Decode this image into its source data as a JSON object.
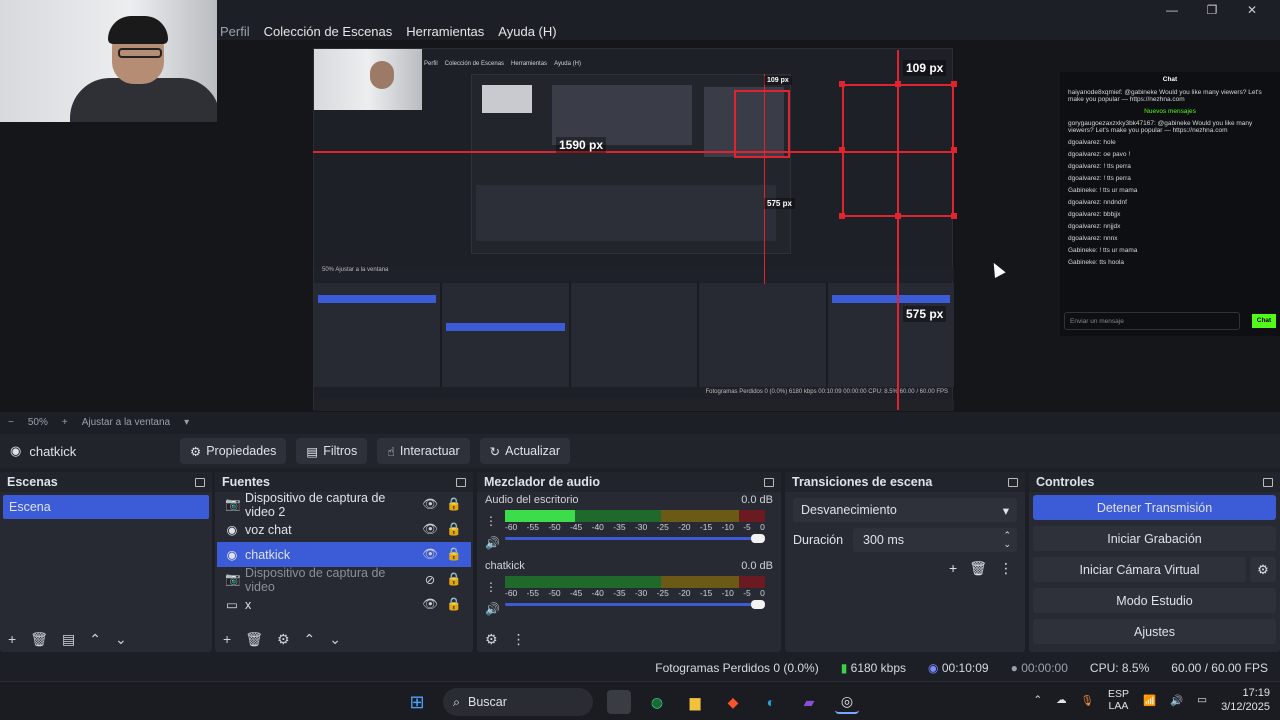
{
  "menu": [
    "Perfil",
    "Colección de Escenas",
    "Herramientas",
    "Ayuda (H)"
  ],
  "window_controls": {
    "minimize": "—",
    "maximize": "❐",
    "close": "✕"
  },
  "preview": {
    "nested_menu": [
      "Perfil",
      "Colección de Escenas",
      "Herramientas",
      "Ayuda (H)"
    ],
    "nested_toolbar": "50%   Ajustar a la ventana",
    "nested_status": "Fotogramas Perdidos 0 (0.0%)   6180 kbps   00:10:09   00:00:00   CPU: 8.5%   60.00 / 60.00 FPS",
    "measure_labels": [
      "109 px",
      "1590 px",
      "575 px",
      "575 px",
      "109 px"
    ]
  },
  "chat": {
    "title": "Chat",
    "new_messages": "Nuevos mensajes",
    "lines": [
      "haiyanode8xqmief: @gabineke Would you like many viewers? Let's make you popular — https://nezhna.com",
      "gorygaugoezaxzxky3bk47167: @gabineke Would you like many viewers? Let's make you popular — https://nezhna.com",
      "dgoalvarez: hole",
      "dgoalvarez: oe pavo !",
      "dgoalvarez: ! tts perra",
      "dgoalvarez: ! tts perra",
      "Gabineke: ! tts ur mama",
      "dgoalvarez: nndndnf",
      "dgoalvarez: bbbjjx",
      "dgoalvarez: nnjjdx",
      "dgoalvarez: nnnx",
      "Gabineke: ! tts ur mama",
      "Gabineke: tts hoola"
    ],
    "input_placeholder": "Enviar un mensaje",
    "send_label": "Chat"
  },
  "zoom": {
    "minus": "−",
    "level": "50%",
    "plus": "+",
    "fit": "Ajustar a la ventana"
  },
  "source_toolbar": {
    "current_source": "chatkick",
    "buttons": [
      "Propiedades",
      "Filtros",
      "Interactuar",
      "Actualizar"
    ]
  },
  "docks": {
    "scenes": {
      "title": "Escenas",
      "items": [
        "Escena"
      ]
    },
    "sources": {
      "title": "Fuentes",
      "items": [
        {
          "name": "Dispositivo de captura de video 2",
          "icon": "camera-icon",
          "selected": false,
          "dim": false
        },
        {
          "name": "voz chat",
          "icon": "browser-icon",
          "selected": false,
          "dim": false
        },
        {
          "name": "chatkick",
          "icon": "browser-icon",
          "selected": true,
          "dim": false
        },
        {
          "name": "Dispositivo de captura de video",
          "icon": "camera-icon",
          "selected": false,
          "dim": true
        },
        {
          "name": "x",
          "icon": "display-icon",
          "selected": false,
          "dim": false
        }
      ]
    },
    "mixer": {
      "title": "Mezclador de audio",
      "channels": [
        {
          "name": "Audio del escritorio",
          "db": "0.0 dB",
          "level": 0.27
        },
        {
          "name": "chatkick",
          "db": "0.0 dB",
          "level": 0.0
        }
      ],
      "scale": [
        "-60",
        "-55",
        "-50",
        "-45",
        "-40",
        "-35",
        "-30",
        "-25",
        "-20",
        "-15",
        "-10",
        "-5",
        "0"
      ]
    },
    "transitions": {
      "title": "Transiciones de escena",
      "type": "Desvanecimiento",
      "duration_label": "Duración",
      "duration": "300 ms"
    },
    "controls": {
      "title": "Controles",
      "stop_stream": "Detener Transmisión",
      "start_record": "Iniciar Grabación",
      "start_vcam": "Iniciar Cámara Virtual",
      "studio": "Modo Estudio",
      "settings": "Ajustes"
    }
  },
  "status": {
    "dropped": "Fotogramas Perdidos 0 (0.0%)",
    "kbps": "6180 kbps",
    "stream_time": "00:10:09",
    "rec_time": "00:00:00",
    "cpu": "CPU: 8.5%",
    "fps": "60.00 / 60.00 FPS"
  },
  "taskbar": {
    "search": "Buscar",
    "lang1": "ESP",
    "lang2": "LAA",
    "time": "17:19",
    "date": "3/12/2025"
  },
  "colors": {
    "accent": "#3c5bd6",
    "bg": "#1d1f26",
    "dock": "#272a33",
    "red": "#e0232e",
    "kick_green": "#53fc18"
  }
}
